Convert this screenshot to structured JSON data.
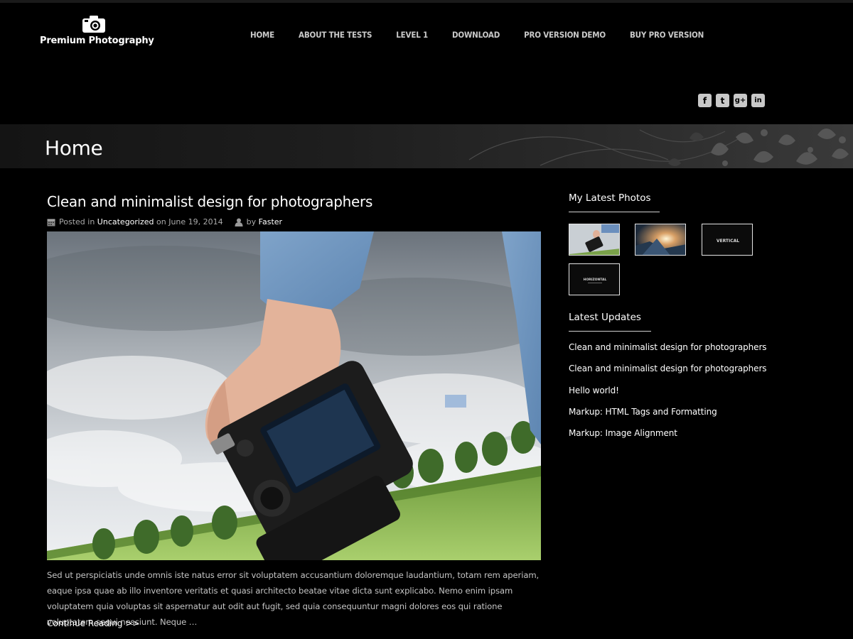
{
  "site": {
    "name": "Premium Photography"
  },
  "nav": {
    "items": [
      {
        "label": "HOME"
      },
      {
        "label": "ABOUT THE TESTS"
      },
      {
        "label": "LEVEL 1"
      },
      {
        "label": "DOWNLOAD"
      },
      {
        "label": "PRO VERSION DEMO"
      },
      {
        "label": "BUY PRO VERSION"
      }
    ]
  },
  "social": {
    "icons": [
      "facebook-icon",
      "twitter-icon",
      "google-plus-icon",
      "linkedin-icon"
    ],
    "glyphs": [
      "f",
      "t",
      "g+",
      "in"
    ]
  },
  "page": {
    "title": "Home"
  },
  "post": {
    "title": "Clean and minimalist design for photographers",
    "posted_in_prefix": "Posted in",
    "category": "Uncategorized",
    "date_prefix": "on",
    "date": "June 19, 2014",
    "by_prefix": "by",
    "author": "Faster",
    "excerpt": "Sed ut perspiciatis unde omnis iste natus error sit voluptatem accusantium doloremque laudantium, totam rem aperiam, eaque ipsa quae ab illo inventore veritatis et quasi architecto beatae vitae dicta sunt explicabo. Nemo enim ipsam voluptatem quia voluptas sit aspernatur aut odit aut fugit, sed quia consequuntur magni dolores eos qui ratione voluptatem sequi nesciunt. Neque …",
    "read_more": "Continue Reading >>"
  },
  "sidebar": {
    "photos_title": "My Latest Photos",
    "thumb_texts": {
      "vertical": "VERTICAL",
      "horizontal": "HORIZONTAL"
    },
    "updates_title": "Latest Updates",
    "updates": [
      "Clean and minimalist design for photographers",
      "Clean and minimalist design for photographers",
      "Hello world!",
      "Markup: HTML Tags and Formatting",
      "Markup: Image Alignment"
    ]
  },
  "colors": {
    "background": "#000000",
    "text": "#ffffff",
    "muted": "#aaaaaa"
  }
}
